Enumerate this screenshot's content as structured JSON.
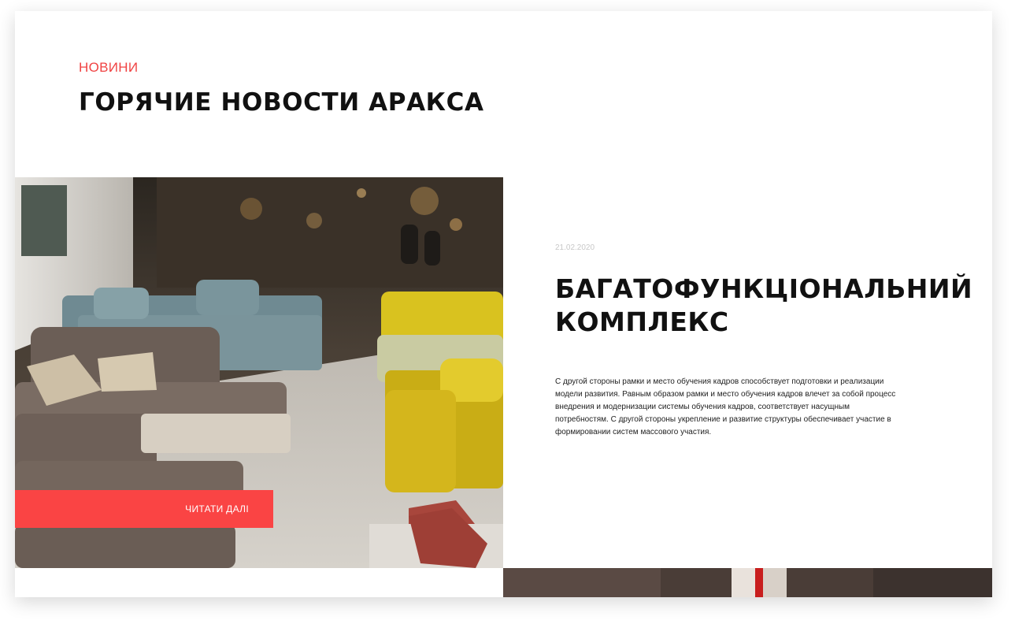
{
  "section": {
    "eyebrow": "НОВИНИ",
    "title": "ГОРЯЧИЕ НОВОСТИ АРАКСА"
  },
  "article": {
    "date": "21.02.2020",
    "title": "БАГАТОФУНКЦІОНАЛЬНИЙ КОМПЛЕКС",
    "body": "С другой стороны рамки и место обучения кадров способствует подготовки и реализации модели развития. Равным образом рамки и место обучения кадров влечет за собой процесс внедрения и модернизации системы обучения кадров, соответствует насущным потребностям. С другой стороны укрепление и развитие структуры обеспечивает участие в формировании систем массового участия.",
    "read_more_label": "ЧИТАТИ ДАЛІ",
    "photo_icon": "sofa-showroom-photo"
  },
  "colors": {
    "accent": "#fa4444",
    "eyebrow": "#f04343",
    "title": "#111111",
    "date": "#c8c8c8"
  }
}
